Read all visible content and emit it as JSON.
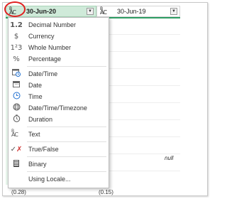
{
  "columns": [
    {
      "type_icon": "ABC-type-icon",
      "label": "30-Jun-20",
      "selected": true
    },
    {
      "type_icon": "ABC-type-icon",
      "label": "30-Jun-19",
      "selected": false
    }
  ],
  "type_icon_text": {
    "top": "B",
    "bottom": "AC"
  },
  "menu": {
    "items": [
      {
        "icon": "1.2",
        "label": "Decimal Number"
      },
      {
        "icon": "$",
        "label": "Currency"
      },
      {
        "icon": "1²3",
        "label": "Whole Number"
      },
      {
        "icon": "%",
        "label": "Percentage"
      },
      {
        "icon": "date-time-icon",
        "label": "Date/Time"
      },
      {
        "icon": "date-icon",
        "label": "Date"
      },
      {
        "icon": "time-icon",
        "label": "Time"
      },
      {
        "icon": "globe-icon",
        "label": "Date/Time/Timezone"
      },
      {
        "icon": "duration-icon",
        "label": "Duration"
      },
      {
        "icon": "ABC-text-icon",
        "label": "Text"
      },
      {
        "icon": "true-false-icon",
        "label": "True/False"
      },
      {
        "icon": "binary-icon",
        "label": "Binary"
      },
      {
        "icon": "",
        "label": "Using Locale..."
      }
    ]
  },
  "cells": {
    "null_value": "null",
    "bottom_left": "(0.28)",
    "bottom_right": "(0.15)"
  },
  "colors": {
    "selected_column": "#cfead9",
    "accent_bar": "#2e9d63",
    "highlight_circle": "#e02020"
  }
}
